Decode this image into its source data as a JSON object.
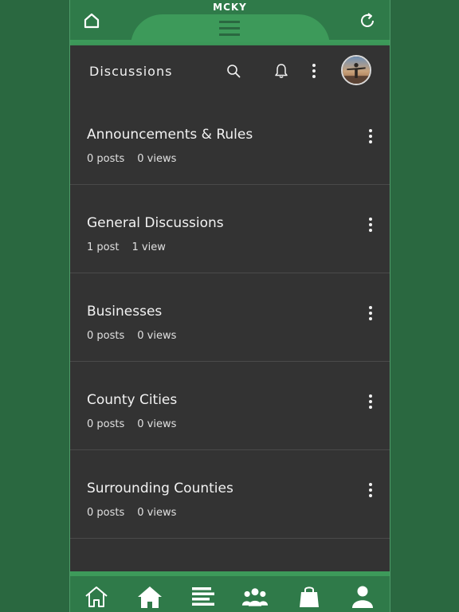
{
  "app": {
    "brand": "MCKY"
  },
  "header": {
    "title": "Discussions"
  },
  "icons": {
    "top_home": "home-outline-icon",
    "top_refresh": "refresh-icon",
    "menu": "hamburger-menu-icon",
    "search": "search-icon",
    "bell": "bell-icon",
    "more": "vertical-dots-icon",
    "avatar": "user-avatar"
  },
  "discussions": [
    {
      "title": "Announcements & Rules",
      "posts": "0 posts",
      "views": "0 views"
    },
    {
      "title": "General Discussions",
      "posts": "1 post",
      "views": "1 view"
    },
    {
      "title": "Businesses",
      "posts": "0 posts",
      "views": "0 views"
    },
    {
      "title": "County Cities",
      "posts": "0 posts",
      "views": "0 views"
    },
    {
      "title": "Surrounding Counties",
      "posts": "0 posts",
      "views": "0 views"
    }
  ],
  "bottom_nav": [
    "home-outline-icon",
    "home-filled-icon",
    "feed-lines-icon",
    "members-group-icon",
    "shopping-bag-icon",
    "profile-icon"
  ],
  "colors": {
    "background_green": "#2a6840",
    "bar_green": "#2f7a49",
    "accent_green": "#3d9a5a",
    "panel": "#333333",
    "text": "#f2f2f2"
  }
}
